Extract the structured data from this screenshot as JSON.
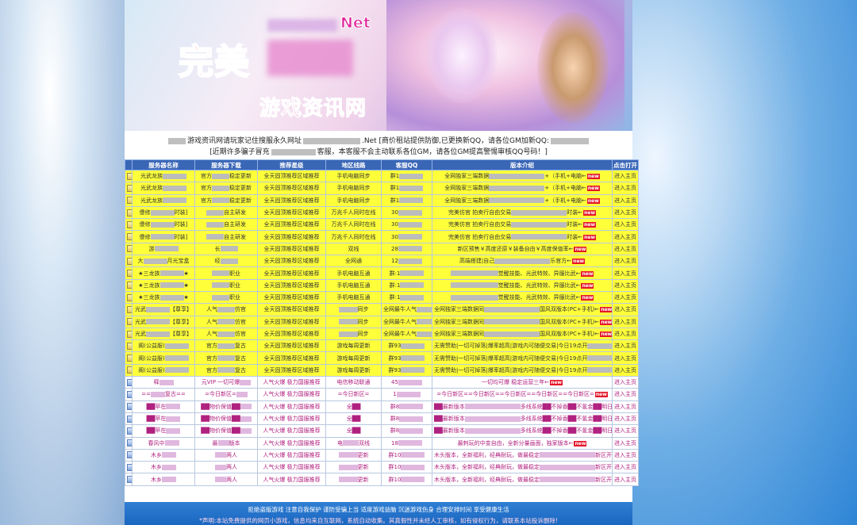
{
  "banner": {
    "title_main": "完美",
    "title_suffix": "Net",
    "title_sub": "游戏资讯网"
  },
  "notice": {
    "line1_a": "游戏资讯网请玩家记住搜服永久网址",
    "line1_b": ".Net [商价租站提供防御,已更换新QQ，请各位GM加新QQ:",
    "line2_a": "[近期许多骗子冒充",
    "line2_b": "客服，本客服不会主动联系各位GM，请各位GM提高警惕审核QQ号码！]"
  },
  "columns": [
    "服务器名称",
    "服务器下载",
    "推荐星级",
    "地区线路",
    "客服QQ",
    "版本介绍",
    "点击打开"
  ],
  "rows": [
    {
      "style": "y",
      "name": "光武龙族",
      "down": "官方",
      "down2": "稳定更新",
      "rec": "全天固顶推荐区域推荐",
      "line": "手机电脑同步",
      "qq": "群1",
      "desc": "全网独家三端数据",
      "desc2": "+（手机+电脑←",
      "go": "进入主页"
    },
    {
      "style": "y",
      "name": "光武龙族",
      "down": "官方",
      "down2": "稳定更新",
      "rec": "全天固顶推荐区域推荐",
      "line": "手机电脑同步",
      "qq": "群1",
      "desc": "全网独家三端数据",
      "desc2": "+（手机+电脑←",
      "go": "进入主页"
    },
    {
      "style": "y",
      "name": "光武龙族",
      "down": "官方",
      "down2": "稳定更新",
      "rec": "全天固顶推荐区域推荐",
      "line": "手机电脑同步",
      "qq": "群1",
      "desc": "全网独家三端数据",
      "desc2": "+（手机+电脑←",
      "go": "进入主页"
    },
    {
      "style": "y",
      "name": "傻修",
      "name2": "时装]",
      "down": "",
      "down2": "自主研发",
      "rec": "全天固顶推荐区域推荐",
      "line": "万兆千人同时在线",
      "qq": "30",
      "desc": "完美仿官 拍卖行自由交易",
      "desc2": "时装←",
      "go": "进入主页"
    },
    {
      "style": "y",
      "name": "傻修",
      "name2": "时装]",
      "down": "",
      "down2": "自主研发",
      "rec": "全天固顶推荐区域推荐",
      "line": "万兆千人同时在线",
      "qq": "30",
      "desc": "完美仿官 拍卖行自由交易",
      "desc2": "时装←",
      "go": "进入主页"
    },
    {
      "style": "y",
      "name": "傻修",
      "name2": "时装]",
      "down": "",
      "down2": "自主研发",
      "rec": "全天固顶推荐区域推荐",
      "line": "万兆千人同时在线",
      "qq": "30",
      "desc": "完美仿官 拍卖行自由交易",
      "desc2": "时装←",
      "go": "进入主页"
    },
    {
      "style": "y",
      "name": "游",
      "name2": "",
      "down": "长",
      "down2": "",
      "rec": "全天固顶推荐区域推荐",
      "line": "双线",
      "qq": "28",
      "desc": "新区预售￥高度还原￥装备自由￥高度保值率←",
      "desc2": "",
      "go": "进入主页"
    },
    {
      "style": "y",
      "name": "大",
      "name2": "月光宝盒",
      "down": "经",
      "down2": "",
      "rec": "全天固顶推荐区域推荐",
      "line": "全网通",
      "qq": "12",
      "desc": "高端搭建|自己",
      "desc2": "乐官方←",
      "go": "进入主页"
    },
    {
      "style": "y",
      "name": "★三龙族",
      "name2": "★",
      "down": "",
      "down2": "职业",
      "rec": "全天固顶推荐区域推荐",
      "line": "手机电脑互通",
      "qq": "群:1",
      "desc": "",
      "desc2": "觉醒技能、光武特效、异服比武←",
      "go": "进入主页"
    },
    {
      "style": "y",
      "name": "★三龙族",
      "name2": "★",
      "down": "",
      "down2": "职业",
      "rec": "全天固顶推荐区域推荐",
      "line": "手机电脑互通",
      "qq": "群:1",
      "desc": "",
      "desc2": "觉醒技能、光武特效、异服比武←",
      "go": "进入主页"
    },
    {
      "style": "y",
      "name": "★三龙族",
      "name2": "★",
      "down": "",
      "down2": "职业",
      "rec": "全天固顶推荐区域推荐",
      "line": "手机电脑互通",
      "qq": "群:1",
      "desc": "",
      "desc2": "觉醒技能、光武特效、异服比武←",
      "go": "进入主页"
    },
    {
      "style": "y",
      "name": "光武",
      "name2": "【尊享】",
      "down": "人气",
      "down2": "仿官",
      "rec": "全天固顶推荐区域推荐",
      "line": "同步",
      "qq": "全网最牛人气",
      "desc": "全网独家三端数据同",
      "desc2": "国风双版本(PC+手机)←",
      "go": "进入主页"
    },
    {
      "style": "y",
      "name": "光武",
      "name2": "【尊享】",
      "down": "人气",
      "down2": "仿官",
      "rec": "全天固顶推荐区域推荐",
      "line": "同步",
      "qq": "全网最牛人气",
      "desc": "全网独家三端数据同",
      "desc2": "国风双版本(PC+手机)←",
      "go": "进入主页"
    },
    {
      "style": "y",
      "name": "光武",
      "name2": "【尊享】",
      "down": "人气",
      "down2": "仿官",
      "rec": "全天固顶推荐区域推荐",
      "line": "同步",
      "qq": "全网最牛人气",
      "desc": "全网独家三端数据同",
      "desc2": "国风双版本(PC+手机)←",
      "go": "进入主页"
    },
    {
      "style": "y",
      "name": "阁(公益服)",
      "name2": "",
      "down": "官方",
      "down2": "复古",
      "rec": "全天固顶推荐区域推荐",
      "line": "游戏每周更新",
      "qq": "群93",
      "desc": "无需赞助|一切可掉落|爆率超高|游戏内可随便交易|今日19点开",
      "desc2": "←",
      "go": "进入主页"
    },
    {
      "style": "y",
      "name": "阁(公益服)",
      "name2": "",
      "down": "官方",
      "down2": "复古",
      "rec": "全天固顶推荐区域推荐",
      "line": "游戏每周更新",
      "qq": "群93",
      "desc": "无需赞助|一切可掉落|爆率超高|游戏内可随便交易|今日19点开",
      "desc2": "←",
      "go": "进入主页"
    },
    {
      "style": "y",
      "name": "阁(公益服)",
      "name2": "",
      "down": "官方",
      "down2": "复古",
      "rec": "全天固顶推荐区域推荐",
      "line": "游戏每周更新",
      "qq": "群93",
      "desc": "无需赞助|一切可掉落|爆率超高|游戏内可随便交易|今日19点开",
      "desc2": "←",
      "go": "进入主页"
    },
    {
      "style": "w",
      "name": "释",
      "name2": "",
      "down": "元VIP 一切可爆",
      "down2": "",
      "rec": "人气火爆 极力国服推荐",
      "line": "电信移动联通",
      "qq": "45",
      "desc": "一切均可爆 稳定运营三年←",
      "desc2": "",
      "go": "进入主页"
    },
    {
      "style": "w",
      "name": "==",
      "name2": "复古==",
      "down": "=今日新区=",
      "down2": "",
      "rec": "人气火爆 极力国服推荐",
      "line": "=今日新区=",
      "qq": "1",
      "desc": "=今日新区==今日新区==今日新区==今日新区==今日新区=",
      "desc2": "",
      "go": "进入主页"
    },
    {
      "style": "w",
      "name": "██苹在",
      "name2": "",
      "down": "██物价保值██",
      "down2": "",
      "rec": "人气火爆 极力国服推荐",
      "line": "全██",
      "qq": "群8",
      "desc": "██最新版本",
      "desc2": "多线系统██不掉香██不氪金██明日新区██←",
      "go": "进入主页"
    },
    {
      "style": "w",
      "name": "██苹在",
      "name2": "",
      "down": "██物价保值██",
      "down2": "",
      "rec": "人气火爆 极力国服推荐",
      "line": "全██",
      "qq": "群8",
      "desc": "██最新版本",
      "desc2": "多线系统██不掉香██不氪金██明日新区██←",
      "go": "进入主页"
    },
    {
      "style": "w",
      "name": "██苹在",
      "name2": "",
      "down": "██物价保值██",
      "down2": "",
      "rec": "人气火爆 极力国服推荐",
      "line": "全██",
      "qq": "群8",
      "desc": "██最新版本",
      "desc2": "多线系统██不掉香██不氪金██明日新区██←",
      "go": "进入主页"
    },
    {
      "style": "w",
      "name": "春风中",
      "name2": "",
      "down": "最",
      "down2": "版本",
      "rec": "人气火爆 极力国服推荐",
      "line": "电",
      "line2": "双线",
      "qq": "18",
      "desc": "最刺玩的中变自由，全新分量画面，独家版本←",
      "desc2": "",
      "go": "进入主页"
    },
    {
      "style": "w",
      "name": "木乡",
      "name2": "",
      "down": "",
      "down2": "两人",
      "rec": "人气火爆 极力国服推荐",
      "line": "更新",
      "qq": "群10",
      "desc": "木头版本，全新福利，经典耐玩，做最稳定",
      "desc2": "新区开启！←",
      "go": "进入主页"
    },
    {
      "style": "w",
      "name": "木乡",
      "name2": "",
      "down": "",
      "down2": "两人",
      "rec": "人气火爆 极力国服推荐",
      "line": "更新",
      "qq": "群10",
      "desc": "木头版本，全新福利，经典耐玩，做最稳定",
      "desc2": "新区开启！←",
      "go": "进入主页"
    },
    {
      "style": "w",
      "name": "木乡",
      "name2": "",
      "down": "",
      "down2": "两人",
      "rec": "人气火爆 极力国服推荐",
      "line": "更新",
      "qq": "群10",
      "desc": "木头版本，全新福利，经典耐玩，做最稳定",
      "desc2": "新区开启！←",
      "go": "进入主页"
    }
  ],
  "hot_label": "new",
  "footer": {
    "line1": "拒绝盗版游戏 注意自我保护 谨防受骗上当 适度游戏益脑 沉迷游戏伤身 合理安排时间 享受健康生活",
    "line2": "*声明:本站免费提供的网页小游戏，信息均来自互联网，系统自动收集。其真假性并未经人工审核，如有侵权行为，请联系本站投诉删除!"
  }
}
